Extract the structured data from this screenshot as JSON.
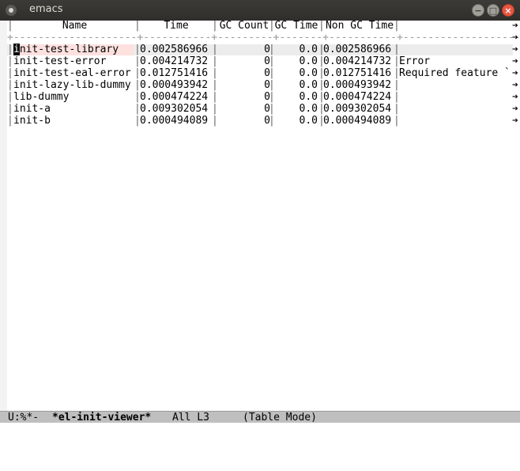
{
  "window": {
    "title": "emacs",
    "minimize_glyph": "−",
    "maximize_glyph": "□",
    "close_glyph": "×"
  },
  "table": {
    "columns": [
      "Name",
      "Time",
      "GC Count",
      "GC Time",
      "Non GC Time"
    ],
    "rows": [
      {
        "name": "init-test-library",
        "time": "0.002586966",
        "gc_count": "0",
        "gc_time": "0.0",
        "non_gc_time": "0.002586966",
        "extra": ""
      },
      {
        "name": "init-test-error",
        "time": "0.004214732",
        "gc_count": "0",
        "gc_time": "0.0",
        "non_gc_time": "0.004214732",
        "extra": "Error"
      },
      {
        "name": "init-test-eal-error",
        "time": "0.012751416",
        "gc_count": "0",
        "gc_time": "0.0",
        "non_gc_time": "0.012751416",
        "extra": "Required feature `"
      },
      {
        "name": "init-lazy-lib-dummy",
        "time": "0.000493942",
        "gc_count": "0",
        "gc_time": "0.0",
        "non_gc_time": "0.000493942",
        "extra": ""
      },
      {
        "name": "lib-dummy",
        "time": "0.000474224",
        "gc_count": "0",
        "gc_time": "0.0",
        "non_gc_time": "0.000474224",
        "extra": ""
      },
      {
        "name": "init-a",
        "time": "0.009302054",
        "gc_count": "0",
        "gc_time": "0.0",
        "non_gc_time": "0.009302054",
        "extra": ""
      },
      {
        "name": "init-b",
        "time": "0.000494089",
        "gc_count": "0",
        "gc_time": "0.0",
        "non_gc_time": "0.000494089",
        "extra": ""
      }
    ]
  },
  "modeline": {
    "status": "U:%*-",
    "buffer_name": "*el-init-viewer*",
    "position": "All L3",
    "mode": "(Table Mode)"
  },
  "truncation_glyph": "➔"
}
